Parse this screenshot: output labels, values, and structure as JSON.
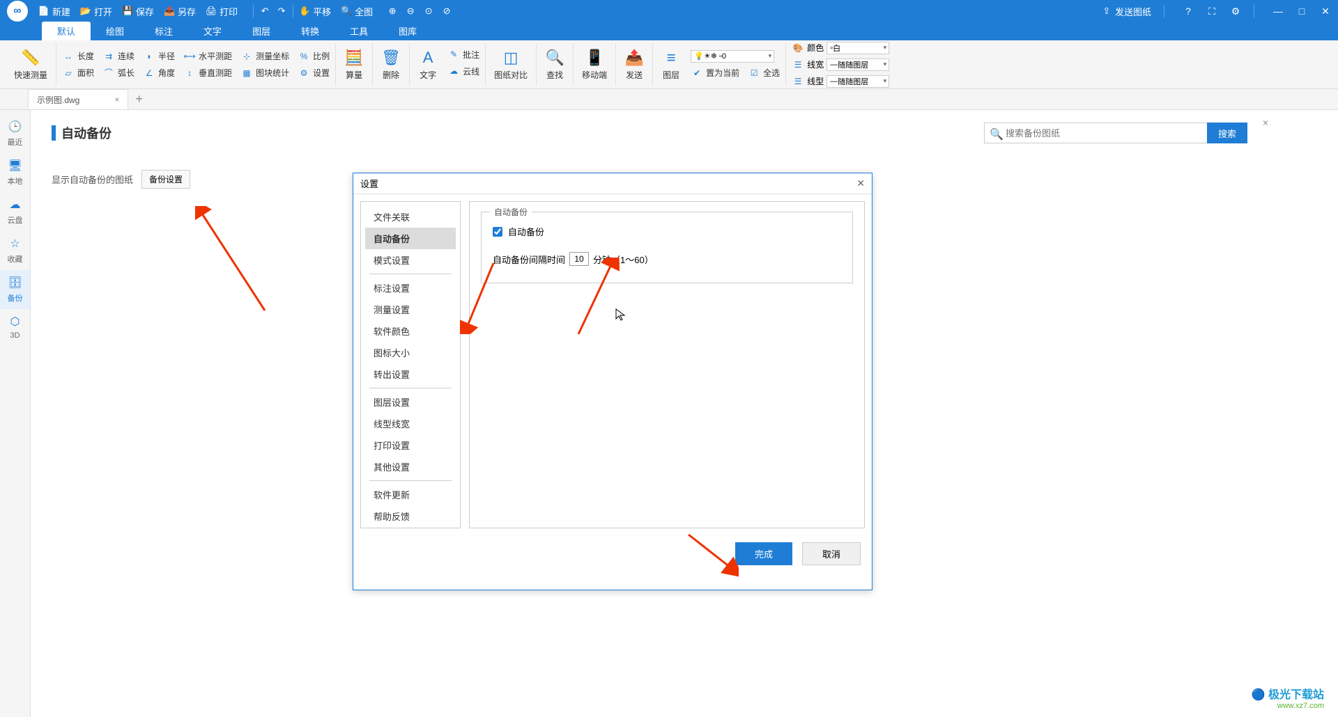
{
  "titlebar": {
    "new": "新建",
    "open": "打开",
    "save": "保存",
    "saveas": "另存",
    "print": "打印",
    "pan": "平移",
    "fullview": "全图",
    "send": "发送图纸"
  },
  "menus": [
    "默认",
    "绘图",
    "标注",
    "文字",
    "图层",
    "转换",
    "工具",
    "图库"
  ],
  "ribbon": {
    "quick_measure": "快速测量",
    "r1": [
      "长度",
      "连续",
      "半径",
      "水平测距",
      "测量坐标",
      "比例"
    ],
    "r2": [
      "面积",
      "弧长",
      "角度",
      "垂直测距",
      "图块统计",
      "设置"
    ],
    "calc": "算量",
    "delete": "删除",
    "text": "文字",
    "anno1": "批注",
    "anno2": "云线",
    "compare": "图纸对比",
    "find": "查找",
    "mobile": "移动端",
    "send": "发送",
    "layer": "图层",
    "layrow1_label": "置为当前",
    "layrow1_label2": "全选",
    "color_label": "颜色",
    "color_val": "白",
    "linew_label": "线宽",
    "linew_val": "随随图层",
    "linet_label": "线型",
    "linet_val": "随随图层",
    "sunbox": "0"
  },
  "file_tab": "示例图.dwg",
  "sidebar": [
    "最近",
    "本地",
    "云盘",
    "收藏",
    "备份",
    "3D"
  ],
  "page": {
    "title": "自动备份",
    "show_backup": "显示自动备份的图纸",
    "backup_settings": "备份设置",
    "search_ph": "搜索备份图纸",
    "search_btn": "搜索"
  },
  "dialog": {
    "title": "设置",
    "nav": [
      "文件关联",
      "自动备份",
      "模式设置",
      "标注设置",
      "测量设置",
      "软件颜色",
      "图标大小",
      "转出设置",
      "图层设置",
      "线型线宽",
      "打印设置",
      "其他设置",
      "软件更新",
      "帮助反馈"
    ],
    "section": "自动备份",
    "cb": "自动备份",
    "interval_label": "自动备份间隔时间",
    "interval_val": "10",
    "interval_suffix": "分钟（1～60）",
    "ok": "完成",
    "cancel": "取消"
  },
  "watermark": {
    "l1": "极光下载站",
    "l2": "www.xz7.com"
  }
}
